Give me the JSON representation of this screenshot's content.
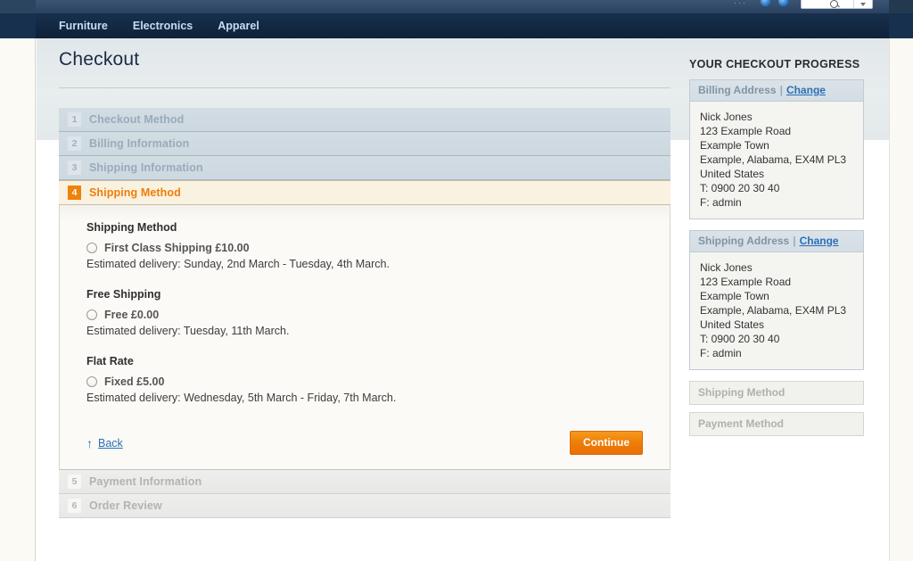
{
  "topbar": {
    "icons": [
      "social-icon-1",
      "social-icon-2"
    ],
    "search_placeholder": ""
  },
  "nav": {
    "links": [
      {
        "label": "Furniture"
      },
      {
        "label": "Electronics"
      },
      {
        "label": "Apparel"
      }
    ]
  },
  "page": {
    "title": "Checkout"
  },
  "steps": [
    {
      "number": "1",
      "label": "Checkout Method",
      "state": "done"
    },
    {
      "number": "2",
      "label": "Billing Information",
      "state": "done"
    },
    {
      "number": "3",
      "label": "Shipping Information",
      "state": "done"
    },
    {
      "number": "4",
      "label": "Shipping Method",
      "state": "active"
    },
    {
      "number": "5",
      "label": "Payment Information",
      "state": "pending"
    },
    {
      "number": "6",
      "label": "Order Review",
      "state": "pending"
    }
  ],
  "shipping": {
    "section_title": "Shipping Method",
    "groups": [
      {
        "title": "Shipping Method",
        "option_label": "First Class Shipping £10.00",
        "eta": "Estimated delivery: Sunday, 2nd March - Tuesday, 4th March.",
        "selected": false
      },
      {
        "title": "Free Shipping",
        "option_label": "Free £0.00",
        "eta": "Estimated delivery: Tuesday, 11th March.",
        "selected": false
      },
      {
        "title": "Flat Rate",
        "option_label": "Fixed £5.00",
        "eta": "Estimated delivery: Wednesday, 5th March - Friday, 7th March.",
        "selected": false
      }
    ],
    "back_label": "Back",
    "back_arrow": "↑",
    "continue_label": "Continue"
  },
  "sidebar": {
    "heading": "YOUR CHECKOUT PROGRESS",
    "billing": {
      "title": "Billing Address",
      "separator": "|",
      "change_label": "Change",
      "lines": [
        "Nick Jones",
        "123 Example Road",
        "Example Town",
        "Example, Alabama, EX4M PL3",
        "United States",
        "T: 0900 20 30 40",
        "F: admin"
      ]
    },
    "shipping_address": {
      "title": "Shipping Address",
      "separator": "|",
      "change_label": "Change",
      "lines": [
        "Nick Jones",
        "123 Example Road",
        "Example Town",
        "Example, Alabama, EX4M PL3",
        "United States",
        "T: 0900 20 30 40",
        "F: admin"
      ]
    },
    "inactive": [
      {
        "label": "Shipping Method"
      },
      {
        "label": "Payment Method"
      }
    ]
  },
  "colors": {
    "accent_orange": "#ef7d08",
    "nav_navy": "#12263f",
    "link_blue": "#2b6fb5",
    "step_done_bg": "#d2dce3",
    "step_active_bg": "#faf2e0"
  }
}
